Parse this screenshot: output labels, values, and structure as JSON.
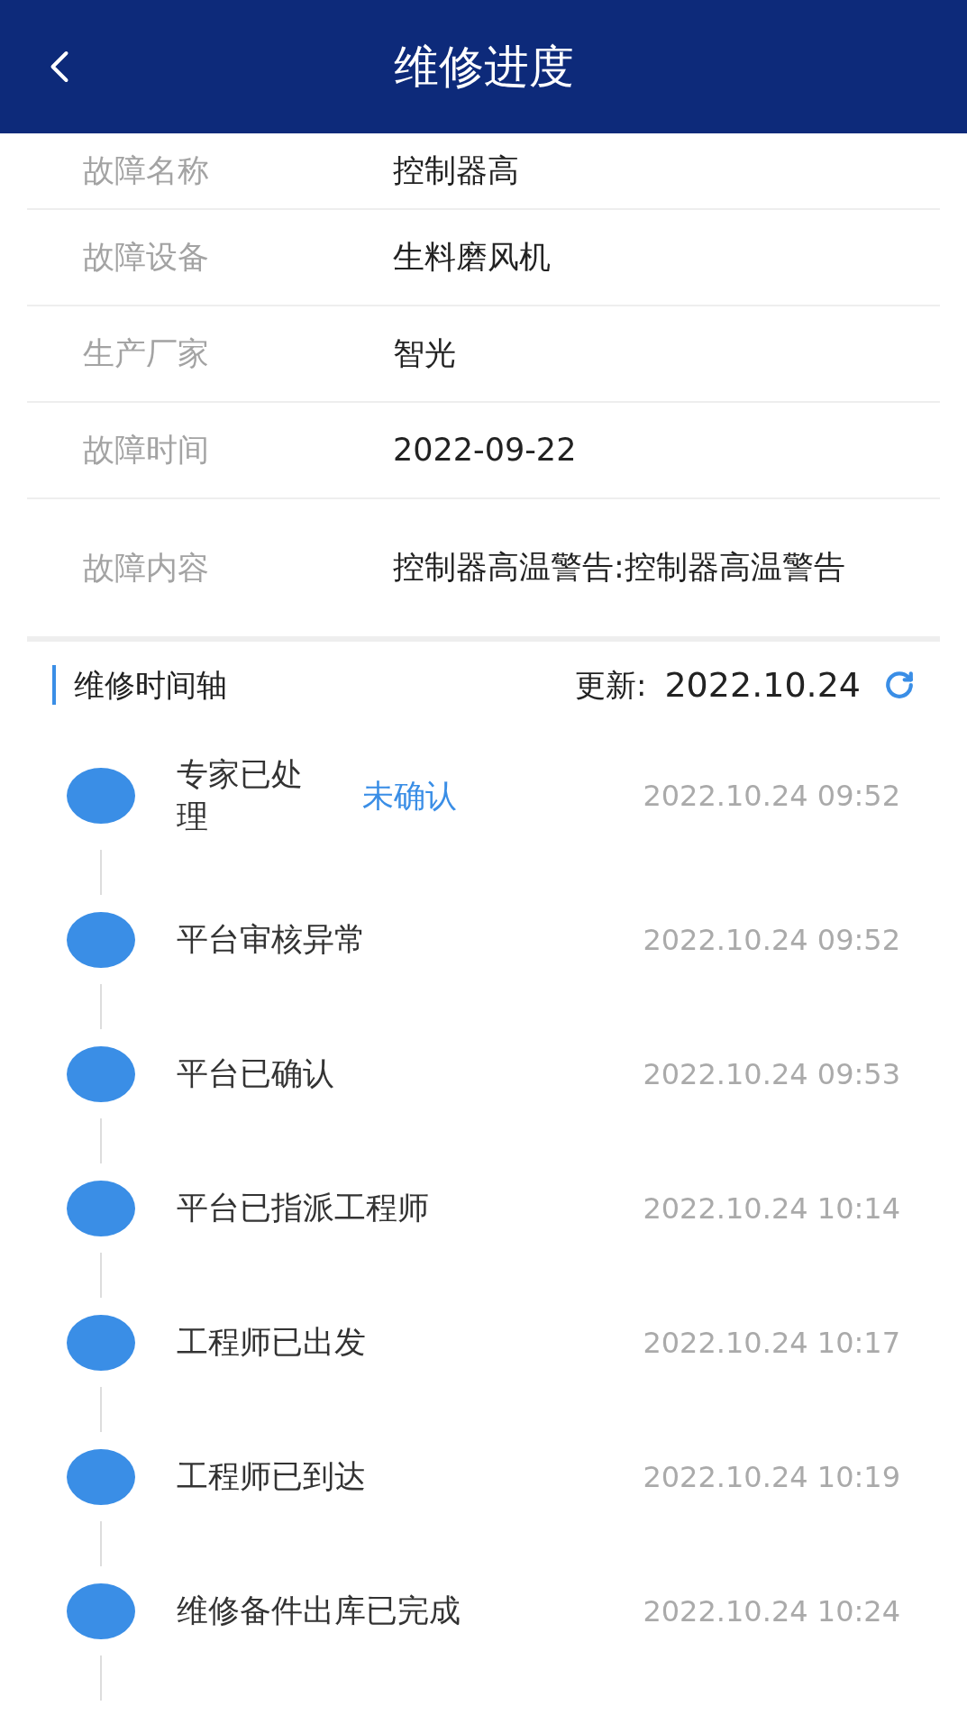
{
  "header": {
    "title": "维修进度"
  },
  "details": [
    {
      "label": "故障名称",
      "value": "控制器高"
    },
    {
      "label": "故障设备",
      "value": "生料磨风机"
    },
    {
      "label": "生产厂家",
      "value": "智光"
    },
    {
      "label": "故障时间",
      "value": "2022-09-22"
    },
    {
      "label": "故障内容",
      "value": "控制器高温警告:控制器高温警告"
    }
  ],
  "timeline": {
    "title": "维修时间轴",
    "updated_label": "更新:",
    "updated_date": "2022.10.24",
    "items": [
      {
        "title": "专家已处理",
        "tag": "未确认",
        "time": "2022.10.24 09:52"
      },
      {
        "title": "平台审核异常",
        "time": "2022.10.24 09:52"
      },
      {
        "title": "平台已确认",
        "time": "2022.10.24 09:53"
      },
      {
        "title": "平台已指派工程师",
        "time": "2022.10.24 10:14"
      },
      {
        "title": "工程师已出发",
        "time": "2022.10.24 10:17"
      },
      {
        "title": "工程师已到达",
        "time": "2022.10.24 10:19"
      },
      {
        "title": "维修备件出库已完成",
        "time": "2022.10.24 10:24"
      }
    ]
  }
}
